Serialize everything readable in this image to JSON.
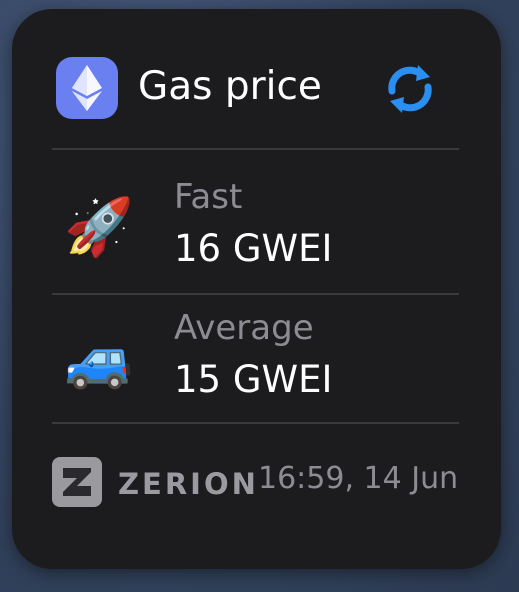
{
  "widget": {
    "title": "Gas price",
    "icons": {
      "header": "ethereum-icon",
      "refresh": "refresh-icon",
      "fast": "rocket-icon",
      "average": "car-icon",
      "brand": "zerion-logo-icon"
    },
    "colors": {
      "accent": "#2a8ff0",
      "eth_tile": "#6a7ff0",
      "background": "#1c1c1f"
    },
    "rows": [
      {
        "emoji": "🚀",
        "label": "Fast",
        "value": "16 GWEI"
      },
      {
        "emoji": "🚙",
        "label": "Average",
        "value": "15 GWEI"
      }
    ],
    "footer": {
      "brand": "ZERION",
      "timestamp": "16:59, 14 Jun"
    }
  }
}
